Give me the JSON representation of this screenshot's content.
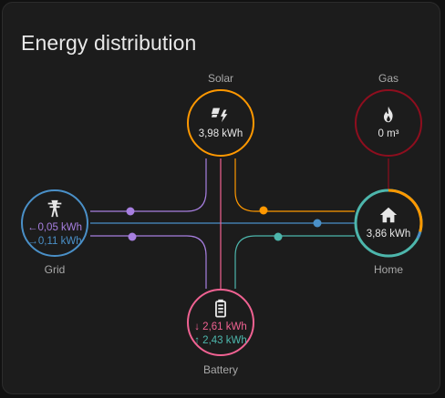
{
  "card": {
    "title": "Energy distribution"
  },
  "solar": {
    "label": "Solar",
    "value": "3,98 kWh",
    "icon": "solar-power-icon"
  },
  "gas": {
    "label": "Gas",
    "value": "0 m³",
    "icon": "fire-icon"
  },
  "grid": {
    "label": "Grid",
    "import_value": "←0,05 kWh",
    "export_value": "→0,11 kWh",
    "icon": "transmission-tower-icon"
  },
  "home": {
    "label": "Home",
    "value": "3,86 kWh",
    "icon": "home-icon"
  },
  "battery": {
    "label": "Battery",
    "charge_value": "↓ 2,61 kWh",
    "discharge_value": "↑ 2,43 kWh",
    "icon": "battery-icon"
  },
  "colors": {
    "solar": "#ff9800",
    "gas": "#8e0e1e",
    "grid": "#4a90c8",
    "grid_export": "#a77fe0",
    "battery": "#f06292",
    "battery_to_home": "#4db6ac"
  }
}
